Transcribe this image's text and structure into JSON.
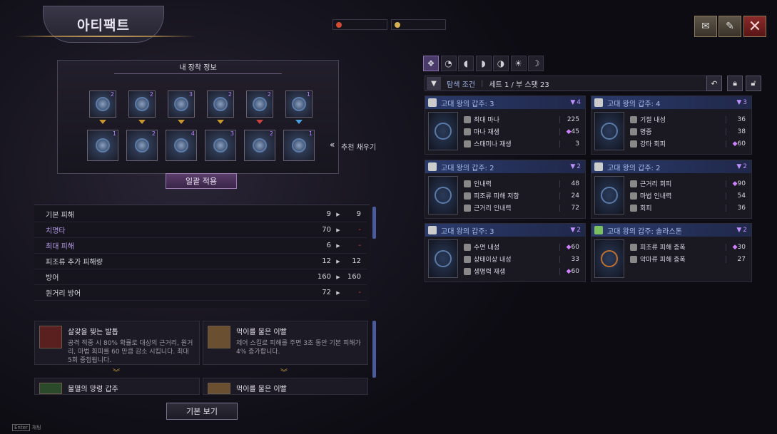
{
  "header": {
    "title": "아티팩트"
  },
  "left": {
    "equip_title": "내 장착 정보",
    "top_slots": [
      {
        "level": "2"
      },
      {
        "level": "2"
      },
      {
        "level": "3"
      },
      {
        "level": "2"
      },
      {
        "level": "2"
      },
      {
        "level": "1"
      }
    ],
    "bottom_slots": [
      {
        "level": "1"
      },
      {
        "level": "2"
      },
      {
        "level": "4"
      },
      {
        "level": "3"
      },
      {
        "level": "2"
      },
      {
        "level": "1"
      }
    ],
    "apply_all_label": "일괄 적용",
    "recommend_label": "추천 채우기",
    "stats": [
      {
        "label": "기본 피해",
        "current": "9",
        "arrow": "▶",
        "new": "9"
      },
      {
        "label": "치명타",
        "current": "70",
        "arrow": "▶",
        "new": "-"
      },
      {
        "label": "최대 피해",
        "current": "6",
        "arrow": "▶",
        "new": "-"
      },
      {
        "label": "피조류 추가 피해량",
        "current": "12",
        "arrow": "▶",
        "new": "12"
      },
      {
        "label": "방어",
        "current": "160",
        "arrow": "▶",
        "new": "160"
      },
      {
        "label": "원거리 방어",
        "current": "72",
        "arrow": "▶",
        "new": "-"
      }
    ],
    "skills": [
      {
        "name": "살갗을 찢는 발톱",
        "desc": "공격 적중 시 80% 확률로 대상의 근거리, 원거리, 마법 회피를 60 만큼 감소 시킵니다. 최대 5회 중첩됩니다."
      },
      {
        "name": "먹이를 물은 이빨",
        "desc": "제어 스킬로 피해를 주면 3초 동안 기본 피해가 4% 증가합니다."
      },
      {
        "name": "불멸의 망령 갑주",
        "desc": ""
      },
      {
        "name": "먹이를 물은 이빨",
        "desc": ""
      }
    ],
    "basic_view_label": "기본 보기",
    "enter_key": "Enter",
    "enter_hint": "채팅"
  },
  "right": {
    "tabs": [
      "❖",
      "◔",
      "◖",
      "◗",
      "◑",
      "☀",
      "☽"
    ],
    "filter_label": "탐색 조건",
    "filter_value": "세트 1 / 부 스탯 23",
    "sets": [
      {
        "name": "고대 왕의 갑주: 3",
        "count": "4",
        "stats": [
          {
            "name": "최대 마나",
            "value": "225",
            "gem": ""
          },
          {
            "name": "마나 재생",
            "value": "45",
            "gem": "◆"
          },
          {
            "name": "스태미나 재생",
            "value": "3",
            "gem": ""
          }
        ]
      },
      {
        "name": "고대 왕의 갑주: 4",
        "count": "3",
        "stats": [
          {
            "name": "기절 내성",
            "value": "36",
            "gem": ""
          },
          {
            "name": "명중",
            "value": "38",
            "gem": ""
          },
          {
            "name": "강타 회피",
            "value": "60",
            "gem": "◆"
          }
        ]
      },
      {
        "name": "고대 왕의 갑주: 2",
        "count": "2",
        "stats": [
          {
            "name": "인내력",
            "value": "48",
            "gem": ""
          },
          {
            "name": "피조류 피해 저항",
            "value": "24",
            "gem": ""
          },
          {
            "name": "근거리 인내력",
            "value": "72",
            "gem": ""
          }
        ]
      },
      {
        "name": "고대 왕의 갑주: 2",
        "count": "2",
        "stats": [
          {
            "name": "근거리 회피",
            "value": "90",
            "gem": "◆"
          },
          {
            "name": "마법 인내력",
            "value": "54",
            "gem": ""
          },
          {
            "name": "회피",
            "value": "36",
            "gem": ""
          }
        ]
      },
      {
        "name": "고대 왕의 갑주: 3",
        "count": "2",
        "stats": [
          {
            "name": "수면 내성",
            "value": "60",
            "gem": "◆"
          },
          {
            "name": "상태이상 내성",
            "value": "33",
            "gem": ""
          },
          {
            "name": "생명력 재생",
            "value": "60",
            "gem": "◆"
          }
        ]
      },
      {
        "name": "고대 왕의 갑주: 솔라스톤",
        "count": "2",
        "stats": [
          {
            "name": "피조류 피해 증폭",
            "value": "30",
            "gem": "◆"
          },
          {
            "name": "악마류 피해 증폭",
            "value": "27",
            "gem": ""
          }
        ]
      }
    ]
  },
  "colors": {
    "accent": "#9a7ab0",
    "set_header": "#2a3a6a",
    "gem": "#d080ff",
    "warn": "#e04040"
  }
}
